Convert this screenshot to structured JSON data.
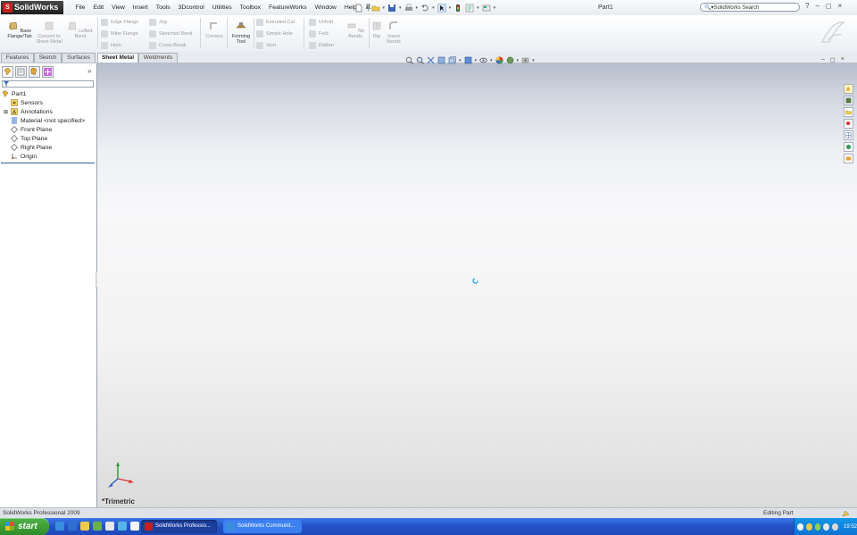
{
  "app": {
    "name": "SolidWorks",
    "document_title": "Part1"
  },
  "menus": [
    "File",
    "Edit",
    "View",
    "Insert",
    "Tools",
    "3Dcontrol",
    "Utilities",
    "Toolbox",
    "FeatureWorks",
    "Window",
    "Help"
  ],
  "search": {
    "value": "SolidWorks Search"
  },
  "window_controls": {
    "help": "?",
    "minimize": "–",
    "restore": "◻",
    "close": "×"
  },
  "commandmanager": {
    "large_tools": [
      {
        "label": "Base Flange/Tab",
        "enabled": true
      },
      {
        "label": "Convert to Sheet Metal",
        "enabled": false
      },
      {
        "label": "Lofted-Bend",
        "enabled": false
      },
      {
        "label": "Corners",
        "enabled": false
      },
      {
        "label": "Forming Tool",
        "enabled": true
      },
      {
        "label": "No Bends",
        "enabled": false
      },
      {
        "label": "Rip",
        "enabled": false
      },
      {
        "label": "Insert Bends",
        "enabled": false
      }
    ],
    "small_tools": {
      "col1": [
        "Edge Flange",
        "Miter Flange",
        "Hem"
      ],
      "col2": [
        "Jog",
        "Sketched Bend",
        "Cross-Break"
      ],
      "col3": [
        "Extruded Cut",
        "Simple Hole",
        "Vent"
      ],
      "col4": [
        "Unfold",
        "Fold",
        "Flatten"
      ]
    }
  },
  "tabs": [
    {
      "label": "Features",
      "active": false
    },
    {
      "label": "Sketch",
      "active": false
    },
    {
      "label": "Surfaces",
      "active": false
    },
    {
      "label": "Sheet Metal",
      "active": true
    },
    {
      "label": "Weldments",
      "active": false
    }
  ],
  "feature_tree": [
    {
      "label": "Part1",
      "icon": "part-icon",
      "indent": 0
    },
    {
      "label": "Sensors",
      "icon": "sensors-icon",
      "indent": 1
    },
    {
      "label": "Annotations",
      "icon": "annotations-icon",
      "indent": 1,
      "expandable": true
    },
    {
      "label": "Material <not specified>",
      "icon": "material-icon",
      "indent": 1
    },
    {
      "label": "Front Plane",
      "icon": "plane-icon",
      "indent": 1
    },
    {
      "label": "Top Plane",
      "icon": "plane-icon",
      "indent": 1
    },
    {
      "label": "Right Plane",
      "icon": "plane-icon",
      "indent": 1
    },
    {
      "label": "Origin",
      "icon": "origin-icon",
      "indent": 1
    }
  ],
  "viewport": {
    "view_orientation": "*Trimetric"
  },
  "status": {
    "left": "SolidWorks Professional 2009",
    "right": "Editing Part"
  },
  "taskbar": {
    "start": "start",
    "tasks": [
      {
        "label": "SolidWorks Professio...",
        "active": true
      },
      {
        "label": "SolidWorks Communit...",
        "active": false
      }
    ],
    "clock": "19:52"
  },
  "colors": {
    "accent_blue": "#2f5ea8",
    "brand_red": "#c8201f",
    "taskbar_blue": "#2453c7",
    "start_green": "#3c9e35"
  }
}
